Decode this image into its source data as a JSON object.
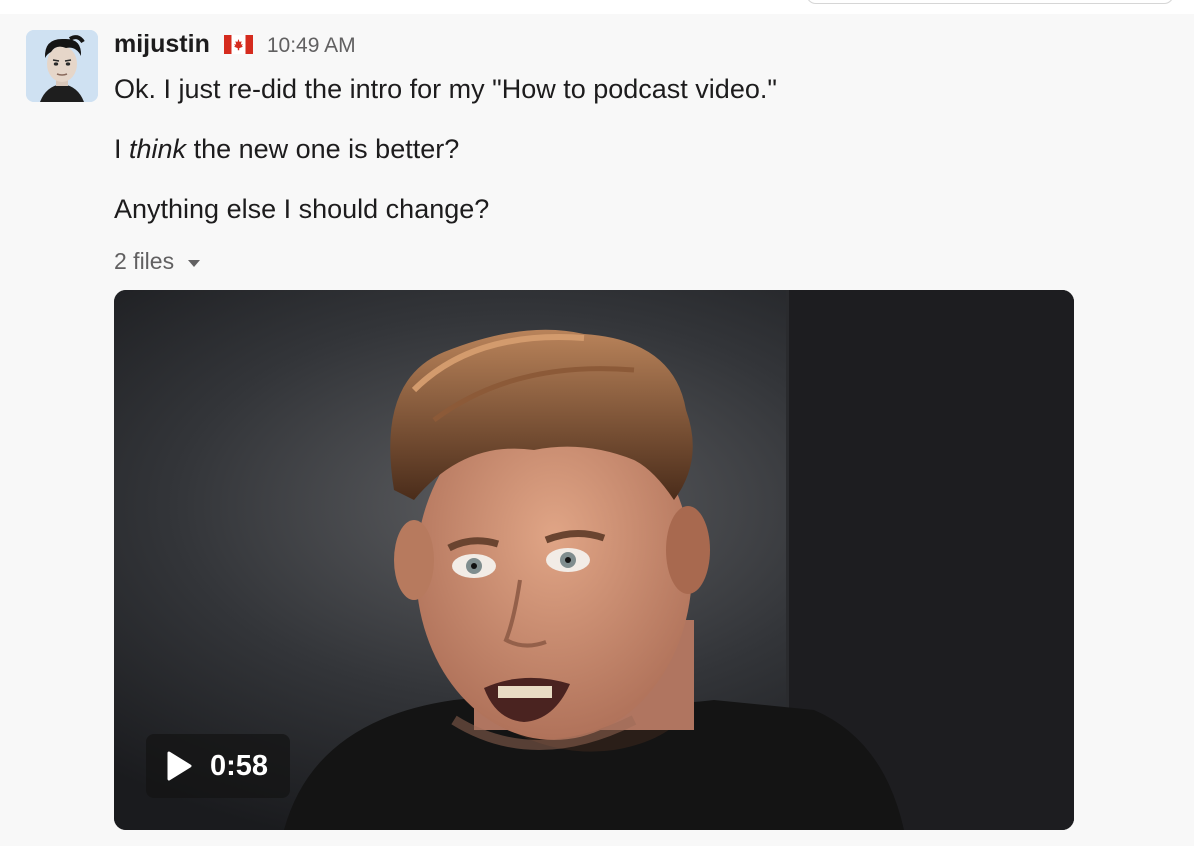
{
  "message": {
    "username": "mijustin",
    "status_emoji": "canada-flag-icon",
    "timestamp": "10:49 AM",
    "line1": "Ok. I just re-did the intro for my \"How to podcast video.\"",
    "line2_prefix": "I ",
    "line2_emphasis": "think",
    "line2_suffix": " the new one is better?",
    "line3": "Anything else I should change?"
  },
  "attachments": {
    "toggle_label": "2 files",
    "toggle_icon": "caret-down-icon",
    "video": {
      "duration": "0:58",
      "play_icon": "play-icon"
    }
  },
  "colors": {
    "background": "#f8f8f8",
    "text": "#1d1c1d",
    "muted": "#616061",
    "flag_red": "#d52b1e"
  }
}
